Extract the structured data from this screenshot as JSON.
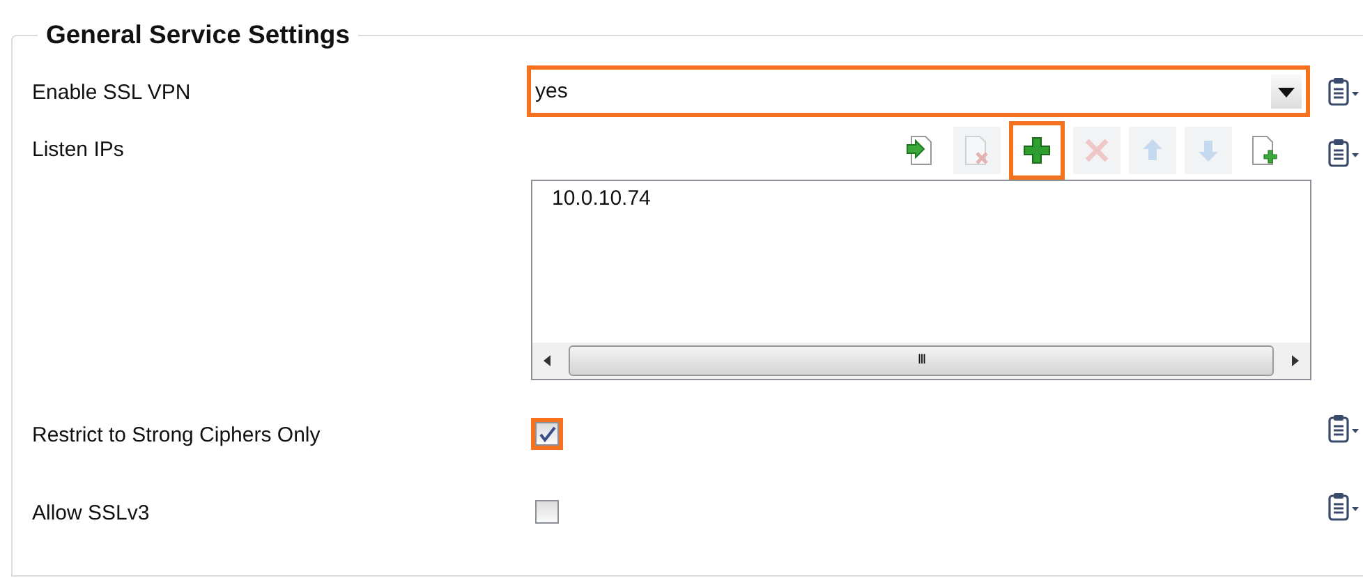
{
  "section": {
    "title": "General Service Settings"
  },
  "settings": [
    {
      "kind": "select",
      "label": "Enable SSL VPN",
      "value": "yes",
      "highlighted": true
    },
    {
      "kind": "list",
      "label": "Listen IPs",
      "tools": [
        {
          "kind": "import",
          "disabled": false,
          "highlighted": false
        },
        {
          "kind": "delete-doc",
          "disabled": true,
          "highlighted": false
        },
        {
          "kind": "add",
          "disabled": false,
          "highlighted": true
        },
        {
          "kind": "remove",
          "disabled": true,
          "highlighted": false
        },
        {
          "kind": "up",
          "disabled": true,
          "highlighted": false
        },
        {
          "kind": "down",
          "disabled": true,
          "highlighted": false
        },
        {
          "kind": "new-doc",
          "disabled": false,
          "highlighted": false
        }
      ],
      "items": [
        "10.0.10.74"
      ],
      "scrollbar_symbol": "III"
    },
    {
      "kind": "checkbox",
      "label": "Restrict to Strong Ciphers Only",
      "checked": true,
      "highlighted": true
    },
    {
      "kind": "checkbox",
      "label": "Allow SSLv3",
      "checked": false,
      "highlighted": false
    }
  ]
}
